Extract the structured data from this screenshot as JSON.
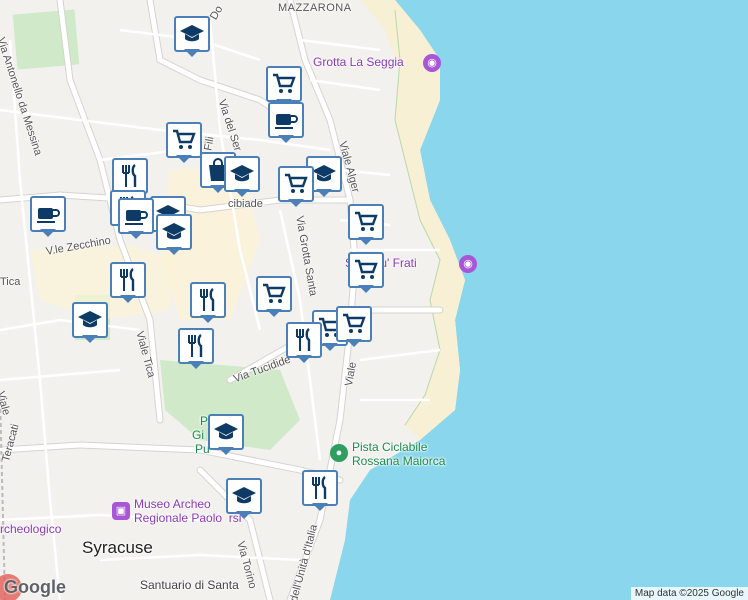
{
  "map": {
    "colors": {
      "land": "#f3f1ee",
      "water": "#8ad6ec",
      "beach": "#f7f0d4",
      "park": "#cfe9c9",
      "road": "#ffffff",
      "road_border": "#d6d3cf",
      "marker_border": "#4a7fb8",
      "marker_icon": "#0d3b66"
    },
    "labels": {
      "district_mazzarona": "MAZZARONA",
      "street_donne": "Do",
      "street_antonello": "Via Antonello da Messina",
      "street_zecchino": "V.le Zecchino",
      "street_tica_left": "Tica",
      "street_viale_tica": "Viale Tica",
      "street_via_del_ser": "Via del Ser",
      "street_via_fili": "Via Fili",
      "street_cibiade": "cibiade",
      "street_viale_algeri": "Viale Alger",
      "street_grotta_santa": "Via Grotta Santa",
      "street_tucidide": "Via Tucidide",
      "street_viale_right": "Viale",
      "street_teracati": "Teracati",
      "street_torino": "Via Torino",
      "street_unita_italia": "dell'Unità d'Italia",
      "street_viale_left2": "Viale",
      "city": "Syracuse",
      "santuario": "Santuario di Santa",
      "archeologico_left": "rcheologico",
      "park_label_p": "P",
      "park_label_gi": "Gi",
      "park_label_pu": "Pu",
      "poi_grotta": "Grotta La Seggia",
      "poi_scoglio": "S       o e ru' Frati",
      "poi_pista": "Pista Ciclabile\nRossana Maiorca",
      "poi_museo": "Museo Archeo\nRegionale Paolo  rsi"
    },
    "attribution": "Map data ©2025 Google",
    "logo": "Google",
    "markers": [
      {
        "icon": "school-icon"
      },
      {
        "icon": "cart-icon"
      },
      {
        "icon": "cafe-icon"
      },
      {
        "icon": "cart-icon"
      },
      {
        "icon": "restaurant-icon"
      },
      {
        "icon": "shopping-bag-icon"
      },
      {
        "icon": "school-icon"
      },
      {
        "icon": "school-icon"
      },
      {
        "icon": "cart-icon"
      },
      {
        "icon": "school-icon"
      },
      {
        "icon": "cafe-icon"
      },
      {
        "icon": "restaurant-icon"
      },
      {
        "icon": "cafe-icon"
      },
      {
        "icon": "school-icon"
      },
      {
        "icon": "cart-icon"
      },
      {
        "icon": "cart-icon"
      },
      {
        "icon": "restaurant-icon"
      },
      {
        "icon": "school-icon"
      },
      {
        "icon": "cart-icon"
      },
      {
        "icon": "restaurant-icon"
      },
      {
        "icon": "restaurant-icon"
      },
      {
        "icon": "cart-icon"
      },
      {
        "icon": "cart-icon"
      },
      {
        "icon": "restaurant-icon"
      },
      {
        "icon": "school-icon"
      },
      {
        "icon": "restaurant-icon"
      },
      {
        "icon": "school-icon"
      }
    ]
  }
}
